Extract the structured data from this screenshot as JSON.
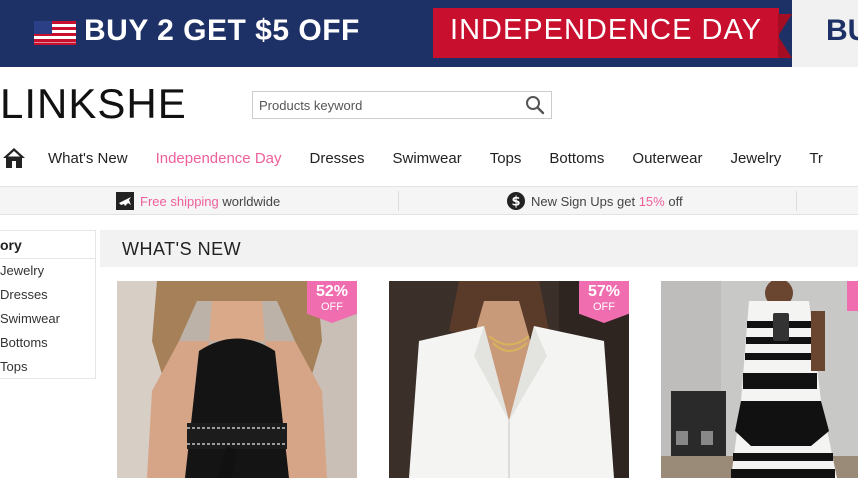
{
  "banner": {
    "left_text": "BUY 2 GET $5 OFF",
    "ribbon_text": "INDEPENDENCE DAY",
    "right_partial": "BU"
  },
  "header": {
    "logo": "LINKSHE",
    "search": {
      "placeholder": "Products keyword",
      "value": ""
    }
  },
  "nav": {
    "items": [
      "What's New",
      "Independence Day",
      "Dresses",
      "Swimwear",
      "Tops",
      "Bottoms",
      "Outerwear",
      "Jewelry",
      "Tr"
    ],
    "highlight_color": "#ee5f9b"
  },
  "infobar": {
    "shipping_highlight": "Free shipping",
    "shipping_rest": "worldwide",
    "signup_prefix": "New Sign Ups get",
    "signup_pct": "15%",
    "signup_suffix": "off"
  },
  "sidebar": {
    "heading": "ory",
    "categories": [
      "Jewelry",
      "Dresses",
      "Swimwear",
      "Bottoms",
      "Tops"
    ]
  },
  "main": {
    "section_title": "WHAT'S NEW",
    "products": [
      {
        "discount": "52%",
        "off": "OFF"
      },
      {
        "discount": "57%",
        "off": "OFF"
      },
      {
        "discount": "",
        "off": ""
      }
    ]
  },
  "colors": {
    "banner_bg": "#1e3166",
    "ribbon": "#c8102e",
    "brand_pink": "#ee5f9b",
    "badge_pink": "#f06eb0"
  }
}
